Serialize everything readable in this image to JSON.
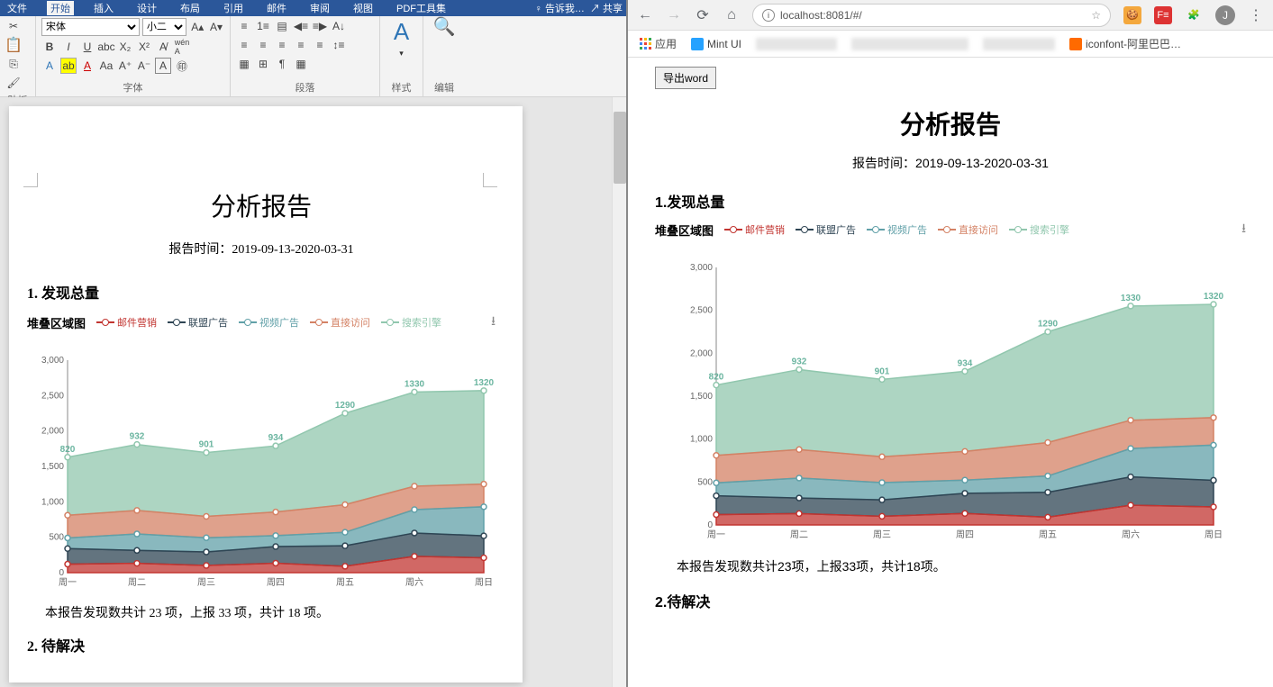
{
  "word": {
    "tabs": [
      "文件",
      "开始",
      "插入",
      "设计",
      "布局",
      "引用",
      "邮件",
      "审阅",
      "视图",
      "PDF工具集"
    ],
    "tell_me": "告诉我…",
    "share": "共享",
    "font_name": "宋体",
    "font_size": "小二",
    "groups": {
      "clipboard": "贴板",
      "font": "字体",
      "paragraph": "段落",
      "styles": "样式",
      "editing": "编辑"
    },
    "doc": {
      "title": "分析报告",
      "subtitle": "报告时间：2019-09-13-2020-03-31",
      "h1": "1. 发现总量",
      "summary": "本报告发现数共计 23 项，上报 33 项，共计 18 项。",
      "h2": "2. 待解决"
    }
  },
  "browser": {
    "url": "localhost:8081/#/",
    "bookmarks": {
      "apps": "应用",
      "mint": "Mint UI",
      "iconfont": "iconfont-阿里巴巴…"
    },
    "export_btn": "导出word",
    "avatar_initial": "J",
    "doc": {
      "title": "分析报告",
      "subtitle": "报告时间：2019-09-13-2020-03-31",
      "h1": "1.发现总量",
      "summary": "本报告发现数共计23项，上报33项，共计18项。",
      "h2": "2.待解决"
    }
  },
  "chart_data": {
    "type": "area",
    "title": "堆叠区域图",
    "categories": [
      "周一",
      "周二",
      "周三",
      "周四",
      "周五",
      "周六",
      "周日"
    ],
    "ylabel": "",
    "ylim": [
      0,
      3000
    ],
    "yticks": [
      0,
      500,
      1000,
      1500,
      2000,
      2500,
      3000
    ],
    "series": [
      {
        "name": "邮件营销",
        "color": "#c23531",
        "values": [
          120,
          132,
          101,
          134,
          90,
          230,
          210
        ]
      },
      {
        "name": "联盟广告",
        "color": "#2f4554",
        "values": [
          220,
          182,
          191,
          234,
          290,
          330,
          310
        ]
      },
      {
        "name": "视频广告",
        "color": "#61a0a8",
        "values": [
          150,
          232,
          201,
          154,
          190,
          330,
          410
        ]
      },
      {
        "name": "直接访问",
        "color": "#d48265",
        "values": [
          320,
          332,
          301,
          334,
          390,
          330,
          320
        ]
      },
      {
        "name": "搜索引擎",
        "color": "#91c7ae",
        "values": [
          820,
          932,
          901,
          934,
          1290,
          1330,
          1320
        ]
      }
    ],
    "top_labels": [
      820,
      932,
      901,
      934,
      1290,
      1330,
      1320
    ]
  }
}
